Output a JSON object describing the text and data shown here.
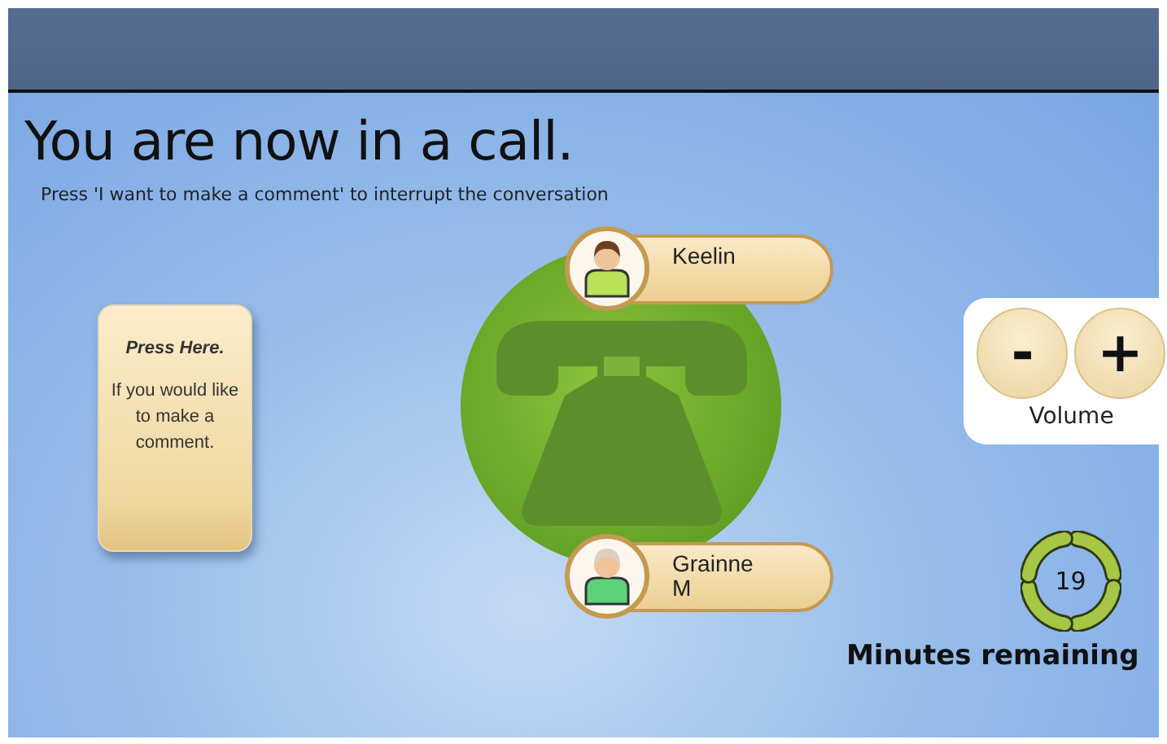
{
  "title": "You are now in a call.",
  "instruction": "Press 'I want to make a comment' to interrupt the conversation",
  "comment_button": {
    "heading": "Press Here.",
    "text": "If you would like to make a comment."
  },
  "participants": [
    {
      "name": "Keelin",
      "kind": "brown-hair"
    },
    {
      "name": "Grainne M",
      "kind": "grey-hair"
    }
  ],
  "volume": {
    "decrease": "-",
    "increase": "+",
    "label": "Volume"
  },
  "timer": {
    "minutes": "19",
    "label": "Minutes remaining"
  }
}
